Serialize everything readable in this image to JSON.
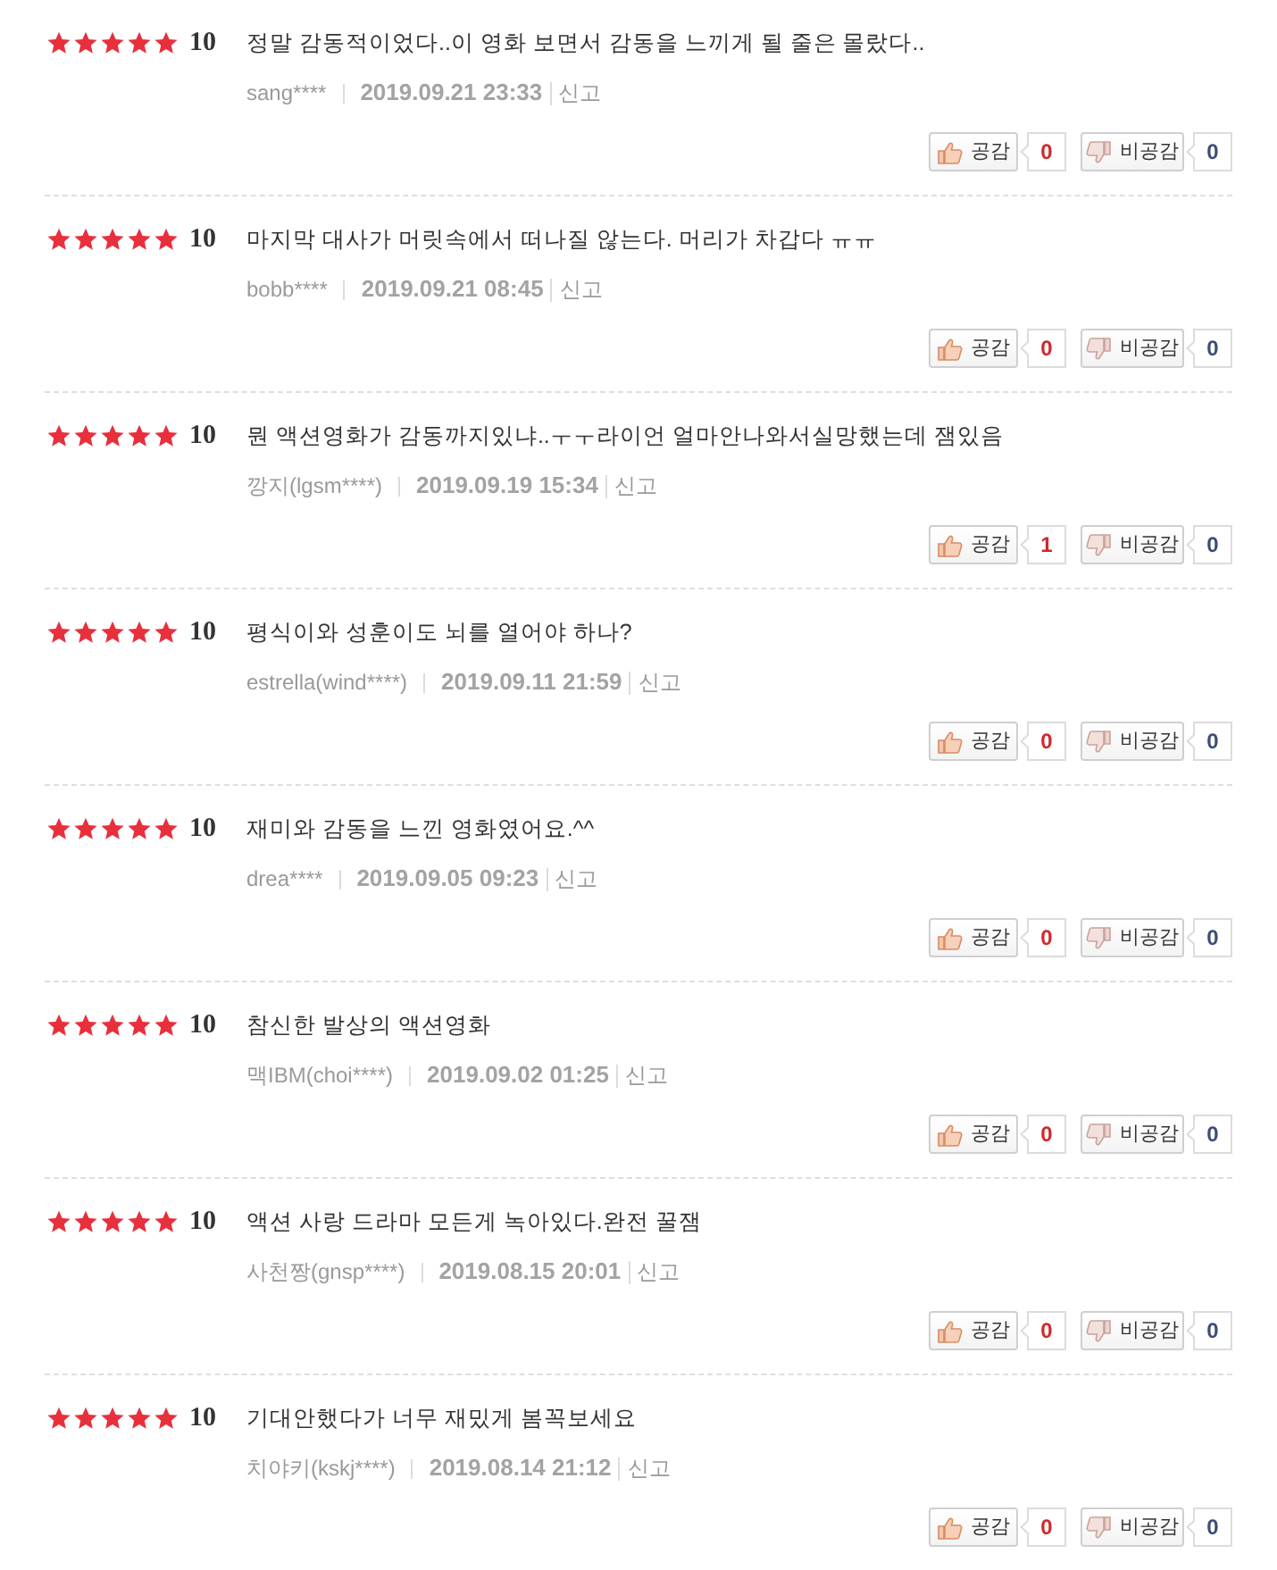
{
  "reviews": [
    {
      "stars": 5,
      "score": "10",
      "text": "정말 감동적이었다..이 영화 보면서 감동을 느끼게 될 줄은 몰랐다..",
      "author": "sang****",
      "date": "2019.09.21 23:33",
      "report": "신고",
      "like_label": "공감",
      "like_count": "0",
      "dislike_label": "비공감",
      "dislike_count": "0"
    },
    {
      "stars": 5,
      "score": "10",
      "text": "마지막 대사가 머릿속에서 떠나질 않는다. 머리가 차갑다 ㅠㅠ",
      "author": "bobb****",
      "date": "2019.09.21 08:45",
      "report": "신고",
      "like_label": "공감",
      "like_count": "0",
      "dislike_label": "비공감",
      "dislike_count": "0"
    },
    {
      "stars": 5,
      "score": "10",
      "text": "뭔 액션영화가 감동까지있냐..ㅜㅜ라이언 얼마안나와서실망했는데 잼있음",
      "author": "깡지(lgsm****)",
      "date": "2019.09.19 15:34",
      "report": "신고",
      "like_label": "공감",
      "like_count": "1",
      "dislike_label": "비공감",
      "dislike_count": "0"
    },
    {
      "stars": 5,
      "score": "10",
      "text": "평식이와 성훈이도 뇌를 열어야 하나?",
      "author": "estrella(wind****)",
      "date": "2019.09.11 21:59",
      "report": "신고",
      "like_label": "공감",
      "like_count": "0",
      "dislike_label": "비공감",
      "dislike_count": "0"
    },
    {
      "stars": 5,
      "score": "10",
      "text": "재미와 감동을 느낀 영화였어요.^^",
      "author": "drea****",
      "date": "2019.09.05 09:23",
      "report": "신고",
      "like_label": "공감",
      "like_count": "0",
      "dislike_label": "비공감",
      "dislike_count": "0"
    },
    {
      "stars": 5,
      "score": "10",
      "text": "참신한 발상의 액션영화",
      "author": "맥IBM(choi****)",
      "date": "2019.09.02 01:25",
      "report": "신고",
      "like_label": "공감",
      "like_count": "0",
      "dislike_label": "비공감",
      "dislike_count": "0"
    },
    {
      "stars": 5,
      "score": "10",
      "text": "액션 사랑 드라마 모든게 녹아있다.완전 꿀잼",
      "author": "사천짱(gnsp****)",
      "date": "2019.08.15 20:01",
      "report": "신고",
      "like_label": "공감",
      "like_count": "0",
      "dislike_label": "비공감",
      "dislike_count": "0"
    },
    {
      "stars": 5,
      "score": "10",
      "text": "기대안했다가 너무 재밌게 봄꼭보세요",
      "author": "치야키(kskj****)",
      "date": "2019.08.14 21:12",
      "report": "신고",
      "like_label": "공감",
      "like_count": "0",
      "dislike_label": "비공감",
      "dislike_count": "0"
    }
  ]
}
